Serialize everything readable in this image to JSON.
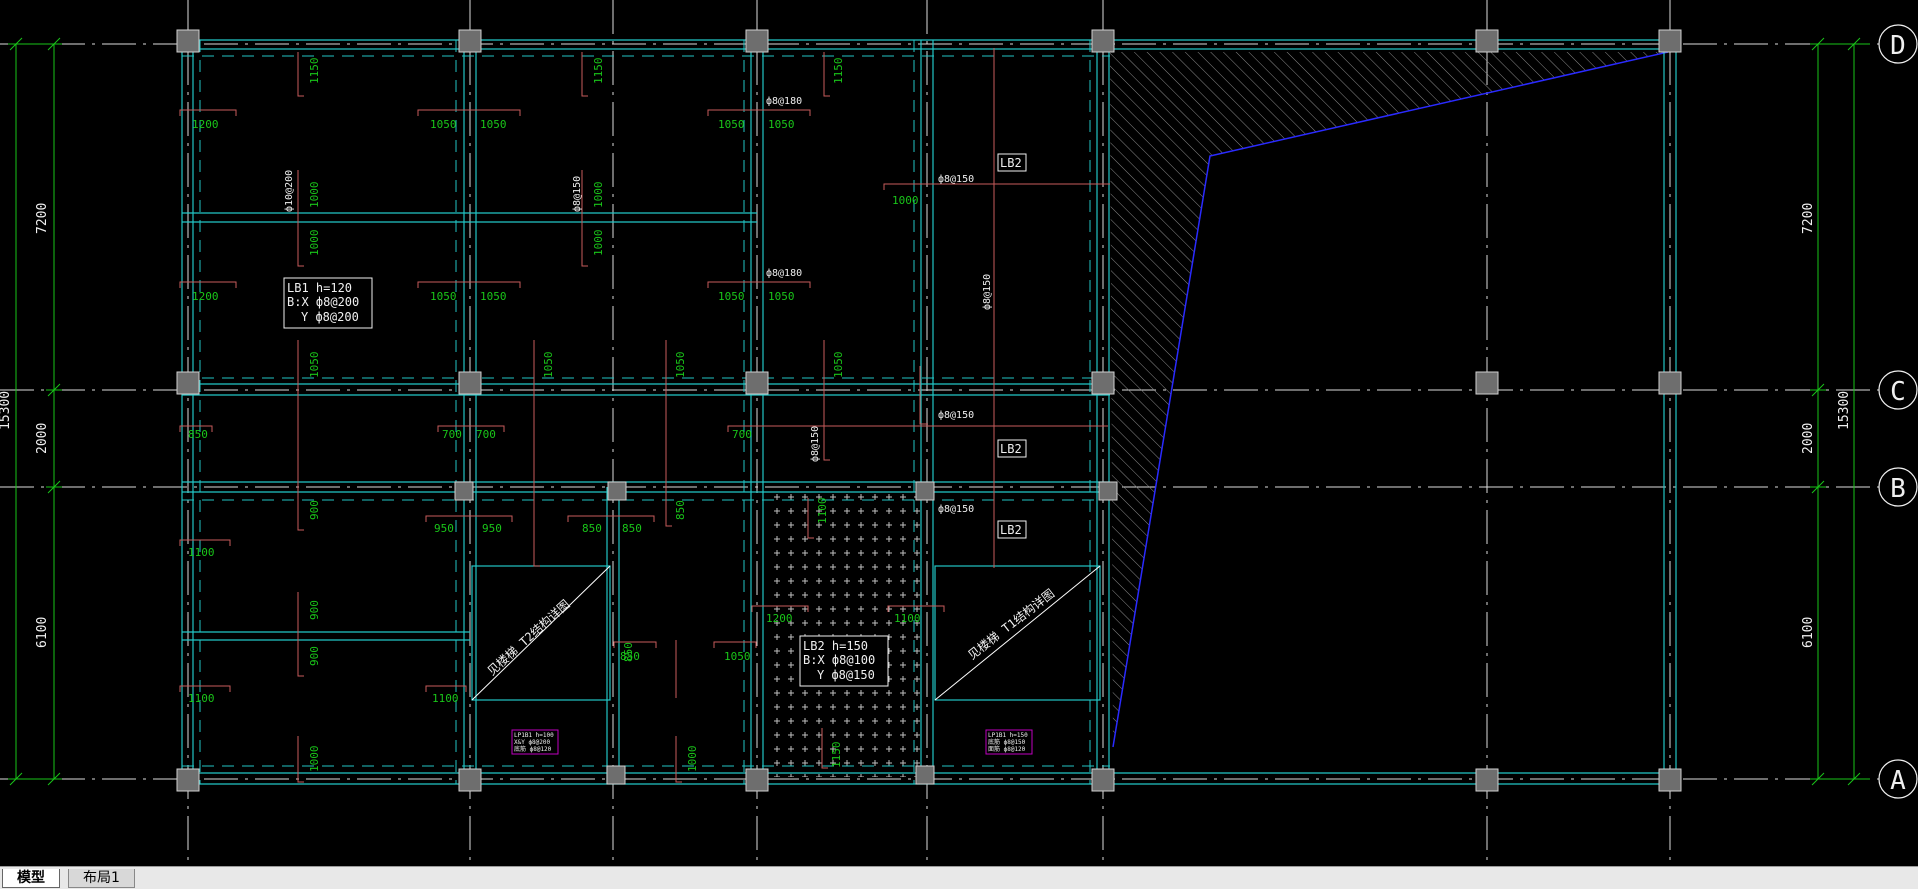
{
  "drawing": {
    "axes": {
      "D": "D",
      "C": "C",
      "B": "B",
      "A": "A"
    },
    "dims_left": {
      "d1": "7200",
      "d2": "2000",
      "d3": "6100",
      "total": "15300"
    },
    "dims_right": {
      "d1": "7200",
      "d2": "2000",
      "d3": "6100",
      "total": "15300"
    },
    "lb1": {
      "l1": "LB1 h=120",
      "l2": "B:X  ф8@200",
      "l3": "Y  ф8@200"
    },
    "lb2_main": {
      "l1": "LB2  h=150",
      "l2": "B:X  ф8@100",
      "l3": "Y  ф8@150"
    },
    "tags": {
      "lb2_a": "LB2",
      "lb2_b": "LB2",
      "lb2_c": "LB2"
    },
    "stairs": {
      "left": "见楼梯  T2结构详图",
      "right": "见楼梯  T1结构详图"
    },
    "rebars": {
      "r1": "ф10@200",
      "r2": "ф8@150",
      "r3": "ф8@180",
      "r4": "ф8@180",
      "r5": "ф8@150",
      "r6": "ф8@150",
      "r7": "ф8@150",
      "r8": "ф8@150",
      "r9": "ф8@150"
    },
    "notes": {
      "m1a": "LP1B1 h=100",
      "m1b": "X&Y ф8@200",
      "m1c": "底筋 ф8@120",
      "m2a": "LP1B1 h=150",
      "m2b": "底筋 ф8@150",
      "m2c": "面筋 ф8@120"
    },
    "labels": {
      "g1": "1200",
      "g2": "1050",
      "g3": "1050",
      "g4": "1050",
      "g5": "1050",
      "g6": "1000",
      "g7": "1200",
      "g8": "1050",
      "g9": "1050",
      "g10": "1050",
      "g11": "1050",
      "g12": "850",
      "g13": "700",
      "g14": "700",
      "g15": "700",
      "g16": "950",
      "g17": "950",
      "g18": "850",
      "g19": "850",
      "g20": "1100",
      "g21": "1100",
      "g22": "1100",
      "g23": "1200",
      "g24": "1100",
      "g25": "1050",
      "g26": "850",
      "v1": "1150",
      "v2": "1150",
      "v3": "1150",
      "v4": "1000",
      "v5": "1000",
      "v6": "1000",
      "v7": "1000",
      "v8": "1050",
      "v9": "1050",
      "v10": "1050",
      "v11": "1050",
      "v12": "900",
      "v13": "850",
      "v14": "900",
      "v15": "900",
      "v16": "1000",
      "v17": "1000",
      "v18": "1100",
      "v19": "1150",
      "v20": "850"
    }
  },
  "tabs": {
    "model": "模型",
    "layout1": "布局1"
  },
  "colors": {
    "background": "#000000",
    "axis": "#ffffff",
    "beam": "#22c5c5",
    "dimension": "#19c519",
    "rebar": "#c75b5b",
    "note_box": "#c000c0",
    "hatch_line": "#2a2aff"
  }
}
